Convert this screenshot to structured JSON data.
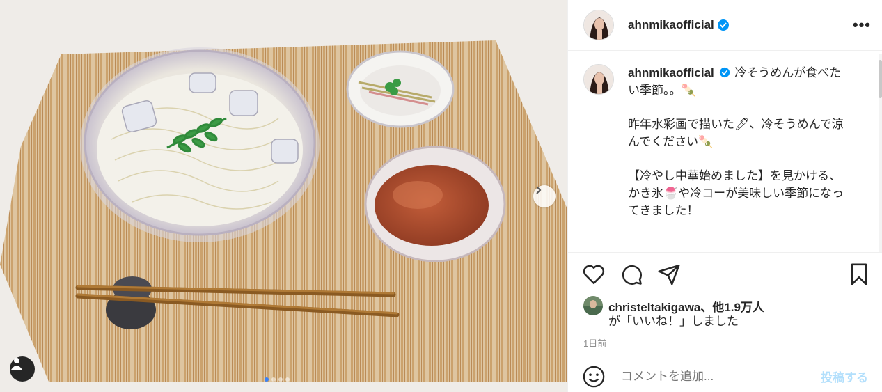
{
  "post": {
    "username": "ahnmikaofficial",
    "verified": true,
    "more_label": "•••"
  },
  "caption": {
    "username": "ahnmikaofficial",
    "paragraphs": [
      "冷そうめんが食べたい季節。。🍡",
      "昨年水彩画で描いた🖊、冷そうめんで涼んでください🍡",
      "【冷やし中華始めました】を見かける、かき氷🍧や冷コーが美味しい季節になってきました！"
    ]
  },
  "likes": {
    "user": "christeltakigawa",
    "others": "、他1.9万人",
    "suffix": "が「いいね！」しました"
  },
  "timestamp": "1日前",
  "comment": {
    "placeholder": "コメントを追加...",
    "post_label": "投稿する"
  },
  "carousel": {
    "total": 4,
    "active_index": 0
  },
  "icons": {
    "like": "heart-icon",
    "comment": "comment-icon",
    "share": "share-icon",
    "save": "bookmark-icon",
    "next": "chevron-right-icon",
    "tag": "user-tag-icon",
    "emoji": "emoji-icon",
    "verified": "verified-badge-icon"
  },
  "colors": {
    "verified_blue": "#0095f6",
    "post_button_disabled": "#b2dffc",
    "muted_text": "#8e8e8e"
  }
}
